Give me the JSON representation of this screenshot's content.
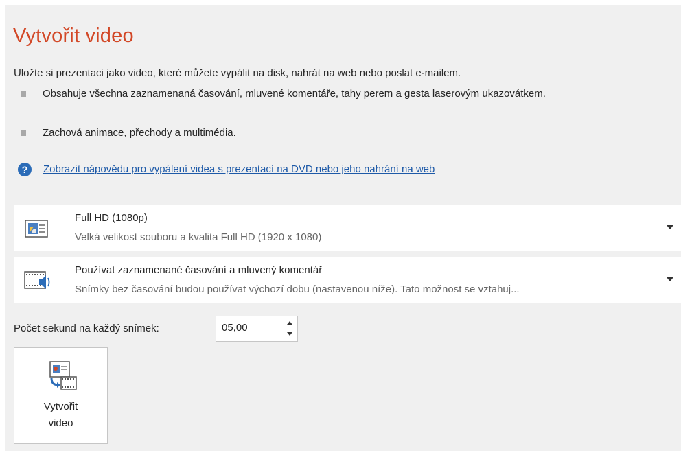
{
  "header": {
    "title": "Vytvořit video",
    "description": "Uložte si prezentaci jako video, které můžete vypálit na disk, nahrát na web nebo poslat e-mailem."
  },
  "bullets": [
    {
      "text": "Obsahuje všechna zaznamenaná časování, mluvené komentáře, tahy perem a gesta laserovým ukazovátkem."
    },
    {
      "text": "Zachová animace, přechody a multimédia."
    }
  ],
  "help": {
    "icon": "question-icon",
    "link_text": "Zobrazit nápovědu pro vypálení videa s prezentací na DVD nebo jeho nahrání na web"
  },
  "quality_dropdown": {
    "icon": "presentation-quality-icon",
    "title": "Full HD (1080p)",
    "subtitle": "Velká velikost souboru a kvalita Full HD (1920 x 1080)"
  },
  "timing_dropdown": {
    "icon": "timing-narration-icon",
    "title": "Používat zaznamenané časování a mluvený komentář",
    "subtitle": "Snímky bez časování budou používat výchozí dobu (nastavenou níže). Tato možnost se vztahuj..."
  },
  "seconds": {
    "label": "Počet sekund na každý snímek:",
    "value": "05,00"
  },
  "create_button": {
    "icon": "create-video-icon",
    "label_line1": "Vytvořit",
    "label_line2": "video"
  },
  "colors": {
    "accent": "#d24726",
    "link": "#1e5aa8",
    "help_icon": "#2b6cb8",
    "panel_bg": "#f0f0f0"
  }
}
